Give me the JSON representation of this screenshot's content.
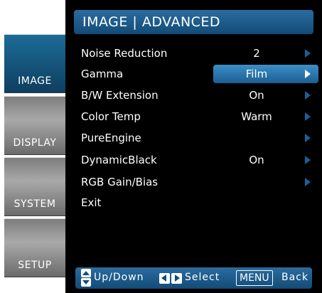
{
  "tabs": [
    {
      "label": "IMAGE",
      "active": true
    },
    {
      "label": "DISPLAY",
      "active": false
    },
    {
      "label": "SYSTEM",
      "active": false
    },
    {
      "label": "SETUP",
      "active": false
    }
  ],
  "panel": {
    "title": "IMAGE | ADVANCED",
    "items": [
      {
        "label": "Noise Reduction",
        "value": "2",
        "has_arrow": true,
        "selected": false
      },
      {
        "label": "Gamma",
        "value": "Film",
        "has_arrow": true,
        "selected": true
      },
      {
        "label": "B/W Extension",
        "value": "On",
        "has_arrow": true,
        "selected": false
      },
      {
        "label": "Color Temp",
        "value": "Warm",
        "has_arrow": true,
        "selected": false
      },
      {
        "label": "PureEngine",
        "value": "",
        "has_arrow": true,
        "selected": false
      },
      {
        "label": "DynamicBlack",
        "value": "On",
        "has_arrow": true,
        "selected": false
      },
      {
        "label": "RGB Gain/Bias",
        "value": "",
        "has_arrow": true,
        "selected": false
      },
      {
        "label": "Exit",
        "value": "",
        "has_arrow": false,
        "selected": false
      }
    ]
  },
  "footer": {
    "updown_label": "Up/Down",
    "select_label": "Select",
    "menu_key": "MENU",
    "back_label": "Back"
  },
  "colors": {
    "accent_blue": "#1b5e93",
    "selected_blue": "#3d8ec7",
    "tab_gray": "#8a8a8a",
    "panel_bg": "#000000"
  },
  "icons": {
    "row_arrow": "chevron-right-icon",
    "updown": "up-down-arrows-icon",
    "leftright": "left-right-arrows-icon"
  }
}
